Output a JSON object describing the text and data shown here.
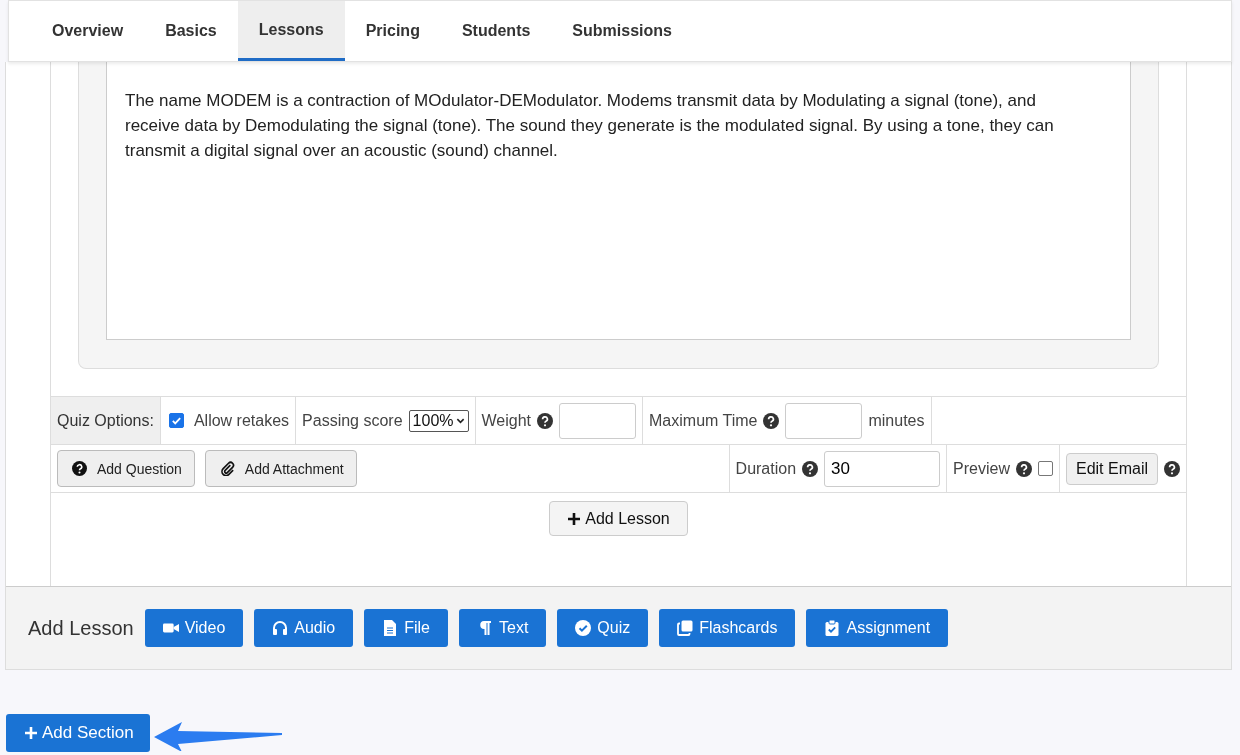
{
  "tabs": [
    {
      "label": "Overview",
      "selected": false
    },
    {
      "label": "Basics",
      "selected": false
    },
    {
      "label": "Lessons",
      "selected": true
    },
    {
      "label": "Pricing",
      "selected": false
    },
    {
      "label": "Students",
      "selected": false
    },
    {
      "label": "Submissions",
      "selected": false
    }
  ],
  "editor": {
    "paragraphs": [
      "The name MODEM is a contraction of MOdulator-DEModulator. Modems transmit data by Modulating a signal (tone), and receive data by Demodulating the signal (tone). The sound they generate is the modulated signal. By using a tone, they can transmit a digital signal over an acoustic (sound) channel."
    ]
  },
  "quiz_options": {
    "label": "Quiz Options:",
    "allow_retakes": {
      "label": "Allow retakes",
      "checked": true
    },
    "passing_score": {
      "label": "Passing score",
      "value": "100%"
    },
    "weight": {
      "label": "Weight"
    },
    "maximum_time": {
      "label": "Maximum Time",
      "unit": "minutes"
    }
  },
  "quiz_actions": {
    "add_question": "Add Question",
    "add_attachment": "Add Attachment",
    "duration": {
      "label": "Duration",
      "value": "30"
    },
    "preview": {
      "label": "Preview",
      "checked": false
    },
    "edit_email": "Edit Email"
  },
  "add_lesson_button": "Add Lesson",
  "add_lesson_bar": {
    "label": "Add Lesson",
    "buttons": [
      {
        "label": "Video",
        "kind": "video"
      },
      {
        "label": "Audio",
        "kind": "audio"
      },
      {
        "label": "File",
        "kind": "file"
      },
      {
        "label": "Text",
        "kind": "text"
      },
      {
        "label": "Quiz",
        "kind": "quiz"
      },
      {
        "label": "Flashcards",
        "kind": "flashcards"
      },
      {
        "label": "Assignment",
        "kind": "assignment"
      }
    ]
  },
  "add_section_button": "Add Section"
}
